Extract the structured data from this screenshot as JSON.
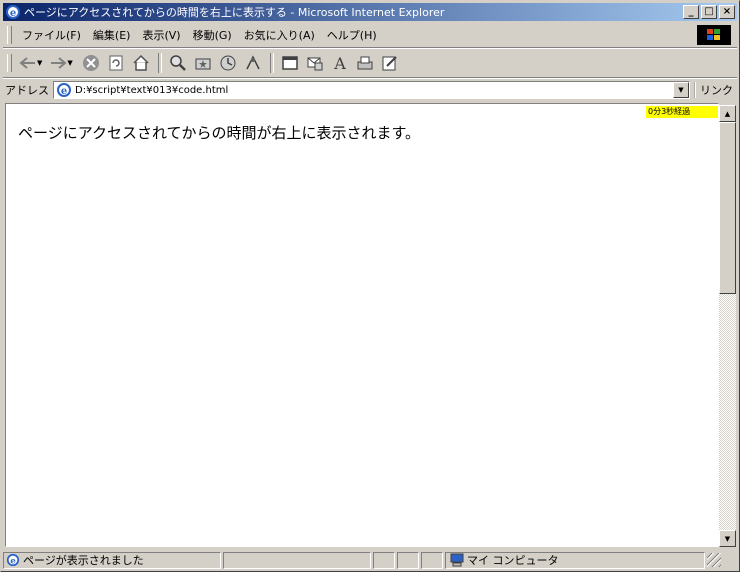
{
  "window": {
    "title": "ページにアクセスされてからの時間を右上に表示する - Microsoft Internet Explorer"
  },
  "menu": {
    "items": [
      "ファイル(F)",
      "編集(E)",
      "表示(V)",
      "移動(G)",
      "お気に入り(A)",
      "ヘルプ(H)"
    ]
  },
  "toolbar": {
    "buttons": [
      "back-icon",
      "forward-icon",
      "stop-icon",
      "refresh-icon",
      "home-icon",
      "search-icon",
      "favorites-icon",
      "history-icon",
      "channels-icon",
      "fullscreen-icon",
      "mail-icon",
      "font-icon",
      "print-icon",
      "edit-icon"
    ]
  },
  "address": {
    "label": "アドレス",
    "value": "D:¥script¥text¥013¥code.html",
    "links_label": "リンク"
  },
  "page": {
    "timer_text": "0分3秒経過",
    "message": "ページにアクセスされてからの時間が右上に表示されます。"
  },
  "status": {
    "text": "ページが表示されました",
    "zone": "マイ コンピュータ"
  },
  "colors": {
    "title_start": "#0a246a",
    "title_end": "#a6caf0",
    "timer_bg": "#ffff00"
  }
}
